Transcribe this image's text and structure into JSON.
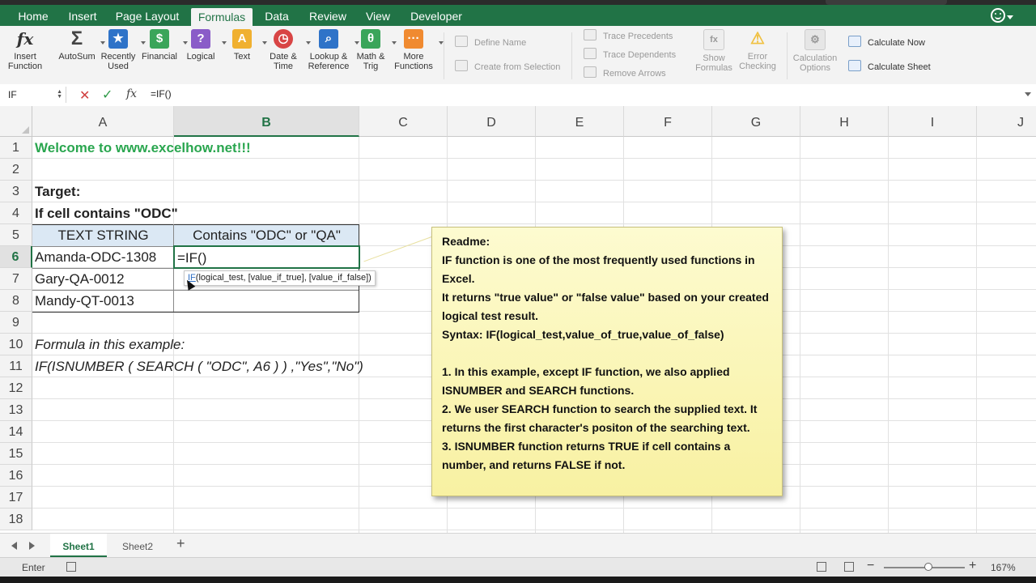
{
  "tabs": [
    "Home",
    "Insert",
    "Page Layout",
    "Formulas",
    "Data",
    "Review",
    "View",
    "Developer"
  ],
  "ribbon": {
    "insert_function": "Insert Function",
    "autosum": "AutoSum",
    "recently_used": "Recently Used",
    "financial": "Financial",
    "logical": "Logical",
    "text": "Text",
    "date_time": "Date & Time",
    "lookup": "Lookup & Reference",
    "math": "Math & Trig",
    "more": "More Functions",
    "define_name": "Define Name",
    "create_from_selection": "Create from Selection",
    "trace_precedents": "Trace Precedents",
    "trace_dependents": "Trace Dependents",
    "remove_arrows": "Remove Arrows",
    "show_formulas": "Show Formulas",
    "error_checking": "Error Checking",
    "calc_options": "Calculation Options",
    "calc_now": "Calculate Now",
    "calc_sheet": "Calculate Sheet"
  },
  "formula_bar": {
    "name_box": "IF",
    "formula": "=IF()"
  },
  "columns": [
    "A",
    "B",
    "C",
    "D",
    "E",
    "F",
    "G",
    "H",
    "I",
    "J"
  ],
  "rows": [
    "1",
    "2",
    "3",
    "4",
    "5",
    "6",
    "7",
    "8",
    "9",
    "10",
    "11",
    "12",
    "13",
    "14",
    "15",
    "16",
    "17",
    "18"
  ],
  "cells": {
    "a1": "Welcome to www.excelhow.net!!!",
    "a3": "Target:",
    "a4": "If cell contains \"ODC\"",
    "a5": "TEXT STRING",
    "b5": "Contains \"ODC\" or \"QA\"",
    "a6": "Amanda-ODC-1308",
    "b6": "=IF()",
    "a7": "Gary-QA-0012",
    "a8": "Mandy-QT-0013",
    "a10": "Formula in this example:",
    "a11": "IF(ISNUMBER ( SEARCH ( \"ODC\", A6 ) ) ,\"Yes\",\"No\")"
  },
  "tooltip": {
    "fn": "IF",
    "args": "(logical_test, [value_if_true], [value_if_false])"
  },
  "note": [
    "Readme:",
    "IF function is one of the most frequently used functions in Excel.",
    "It returns \"true value\" or \"false value\" based on your created logical test result.",
    "Syntax: IF(logical_test,value_of_true,value_of_false)",
    "",
    "1. In this example, except IF function, we also applied ISNUMBER and SEARCH functions.",
    "2. We user SEARCH function to search the supplied text. It returns the first character's positon of the searching text.",
    "3. ISNUMBER function returns TRUE if cell contains a number, and returns FALSE if not."
  ],
  "sheets": [
    "Sheet1",
    "Sheet2"
  ],
  "status": {
    "mode": "Enter",
    "zoom": "167%",
    "zoom_level": 0.55
  },
  "colors": {
    "accent": "#217346",
    "comment_fill": "#f8f1a2",
    "header_fill": "#dbe8f4",
    "green_text": "#2aa64f"
  }
}
